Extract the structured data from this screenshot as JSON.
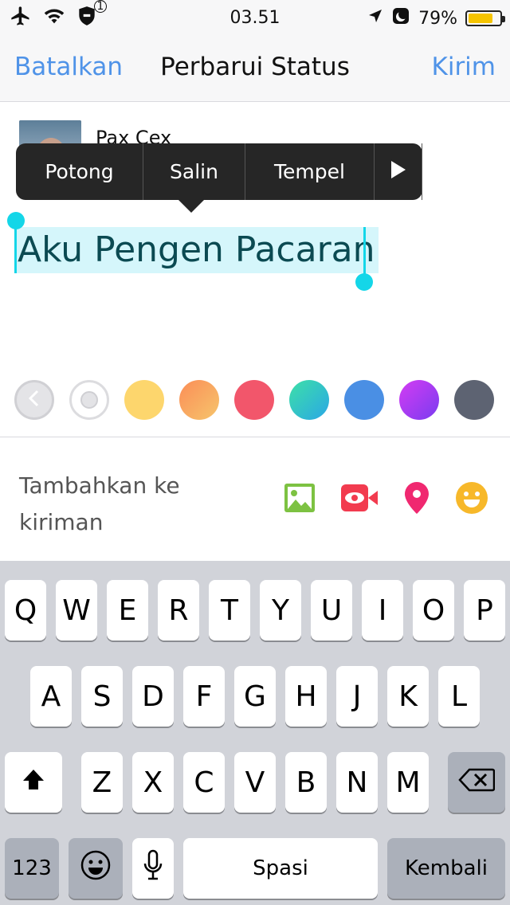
{
  "status_bar": {
    "time": "03.51",
    "battery_percent": "79%",
    "battery_level": 0.79,
    "notification_badge": "1"
  },
  "nav": {
    "cancel": "Batalkan",
    "title": "Perbarui Status",
    "send": "Kirim"
  },
  "compose": {
    "username": "Pax Cex",
    "status_text": "Aku Pengen Pacaran"
  },
  "edit_menu": {
    "items": [
      "Potong",
      "Salin",
      "Tempel"
    ]
  },
  "color_row": {
    "colors": [
      "#ffffff",
      "#fdd66d",
      "linear-gradient(135deg,#fb8d57,#f6c56c)",
      "#f2566b",
      "linear-gradient(135deg,#3de0a7,#2aa7e6)",
      "#4a8fe4",
      "linear-gradient(135deg,#d43df3,#7a3bf0)",
      "#5d6372"
    ]
  },
  "add_to_post": {
    "label": "Tambahkan ke kiriman",
    "icons": [
      "photo-icon",
      "video-icon",
      "location-icon",
      "emoji-icon"
    ],
    "icon_colors": [
      "#7dc242",
      "#f23b4f",
      "#f02870",
      "#f7b82a"
    ]
  },
  "keyboard": {
    "row1": [
      "Q",
      "W",
      "E",
      "R",
      "T",
      "Y",
      "U",
      "I",
      "O",
      "P"
    ],
    "row2": [
      "A",
      "S",
      "D",
      "F",
      "G",
      "H",
      "J",
      "K",
      "L"
    ],
    "row3": [
      "Z",
      "X",
      "C",
      "V",
      "B",
      "N",
      "M"
    ],
    "numbers_key": "123",
    "space_key": "Spasi",
    "return_key": "Kembali"
  }
}
